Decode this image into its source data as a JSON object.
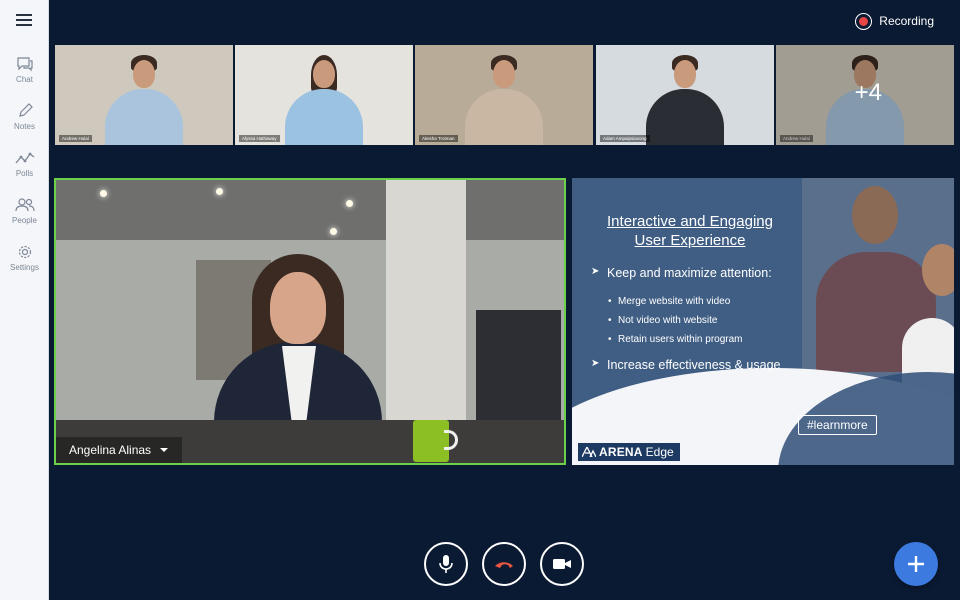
{
  "sidebar": {
    "items": [
      {
        "label": "Chat",
        "icon": "chat-icon"
      },
      {
        "label": "Notes",
        "icon": "pencil-icon"
      },
      {
        "label": "Polls",
        "icon": "polls-icon"
      },
      {
        "label": "People",
        "icon": "people-icon"
      },
      {
        "label": "Settings",
        "icon": "gear-icon"
      }
    ]
  },
  "header": {
    "recording_label": "Recording",
    "recording_color": "#e84545"
  },
  "thumbnails": [
    {
      "name": "Andrew Hulal",
      "bg": "#cfc9bd",
      "shirt": "#a9c4dc"
    },
    {
      "name": "Alyssa Hathaway",
      "bg": "#e5e3de",
      "shirt": "#9cc2e2"
    },
    {
      "name": "Aleisha Trotman",
      "bg": "#b8ac98",
      "shirt": "#c9b7a4"
    },
    {
      "name": "Adam Ampaipsiavong",
      "bg": "#d6dbe0",
      "shirt": "#2a2d34"
    },
    {
      "name": "Andrew Hulal",
      "bg": "#cfc9bd",
      "shirt": "#a9c4dc",
      "overflow": "+4"
    }
  ],
  "main_speaker": {
    "name": "Angelina Alinas",
    "highlight_color": "#6bd04a"
  },
  "slide": {
    "title_line1": "Interactive and Engaging",
    "title_line2": "User Experience",
    "bullet1": "Keep and maximize attention:",
    "sub1": "Merge website with video",
    "sub2": "Not video with website",
    "sub3": "Retain users within program",
    "bullet2": "Increase effectiveness & usage",
    "hashtag": "#learnmore",
    "brand_bold": "ARENA",
    "brand_light": "Edge"
  },
  "controls": {
    "accent": "#3d7ae0",
    "hangup_color": "#e8563f"
  }
}
